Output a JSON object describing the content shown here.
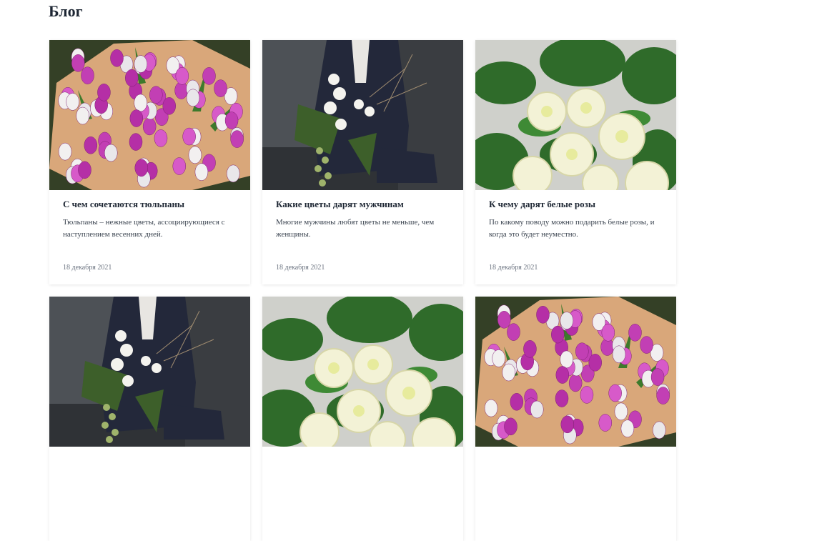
{
  "page": {
    "title": "Блог"
  },
  "posts": [
    {
      "title": "С чем сочетаются тюльпаны",
      "excerpt": "Тюльпаны – нежные цветы, ассоциирующиеся с наступлением весенних дней.",
      "date": "18 декабря 2021",
      "image_icon": "tulip-bouquet-photo"
    },
    {
      "title": "Какие цветы дарят мужчинам",
      "excerpt": "Многие мужчины любят цветы не меньше, чем женщины.",
      "date": "18 декабря 2021",
      "image_icon": "man-with-orchids-photo"
    },
    {
      "title": "К чему дарят белые розы",
      "excerpt": "По какому поводу можно подарить белые розы, и когда это будет неуместно.",
      "date": "18 декабря 2021",
      "image_icon": "white-roses-photo"
    },
    {
      "title": "",
      "excerpt": "",
      "date": "",
      "image_icon": "man-with-orchids-photo"
    },
    {
      "title": "",
      "excerpt": "",
      "date": "",
      "image_icon": "white-roses-photo"
    },
    {
      "title": "",
      "excerpt": "",
      "date": "",
      "image_icon": "tulip-bouquet-photo"
    }
  ],
  "colors": {
    "tulip_pink": "#c23fb4",
    "rose_white": "#f3f2d6",
    "leaf_green": "#3d7a2c",
    "suit_navy": "#23283a",
    "paper_kraft": "#d9a77a"
  }
}
